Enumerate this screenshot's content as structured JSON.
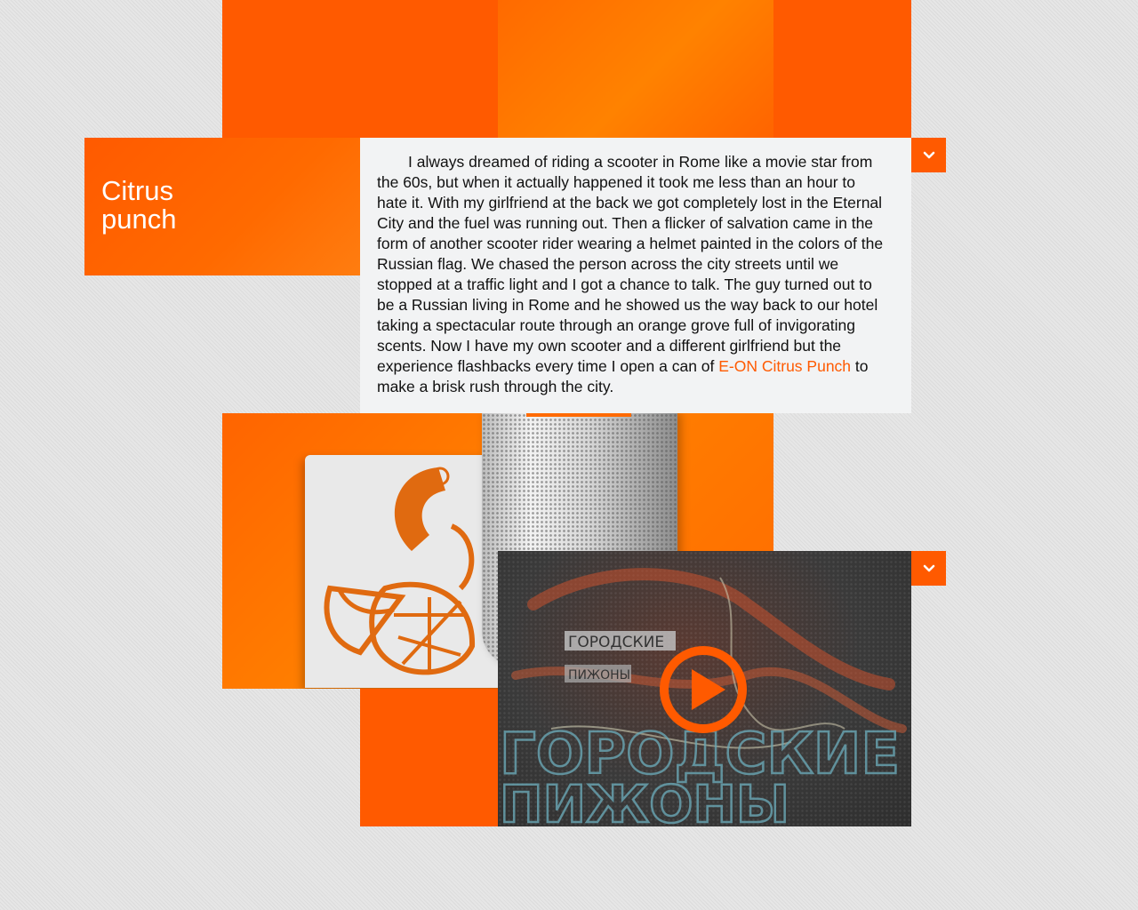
{
  "title": {
    "line1": "Citrus",
    "line2": "punch"
  },
  "story": {
    "text_before_link": "I always dreamed of riding a scooter in Rome like a movie star from the 60s, but when it actually happened it took me less than an hour to hate it. With my girlfriend at the back we got completely lost in the Eternal City and the fuel was running out. Then a flicker of salvation came in the form of another scooter rider wearing a helmet painted in the colors of the Russian flag. We chased the person across the city streets until we stopped at a traffic light and I got a chance to talk. The guy turned out to be a Russian living in Rome and he showed us the way back to our hotel taking a spectacular route through an orange grove full of invigorating scents. Now I have my own scooter and a different girlfriend but the experience flashbacks every time I open a can of ",
    "link_text": "E-ON Citrus Punch",
    "text_after_link": " to make a brisk rush through the city."
  },
  "video": {
    "overlay_small_line1": "ГОРОДСКИЕ",
    "overlay_small_line2": "ПИЖОНЫ",
    "overlay_big_line1": "ГОРОДСКИЕ",
    "overlay_big_line2": "ПИЖОНЫ"
  },
  "icons": {
    "expand_story": "chevron-down-icon",
    "expand_video": "chevron-down-icon",
    "play": "play-icon"
  },
  "colors": {
    "accent": "#ff5a00",
    "text": "#111111",
    "panel": "#f2f3f4"
  }
}
